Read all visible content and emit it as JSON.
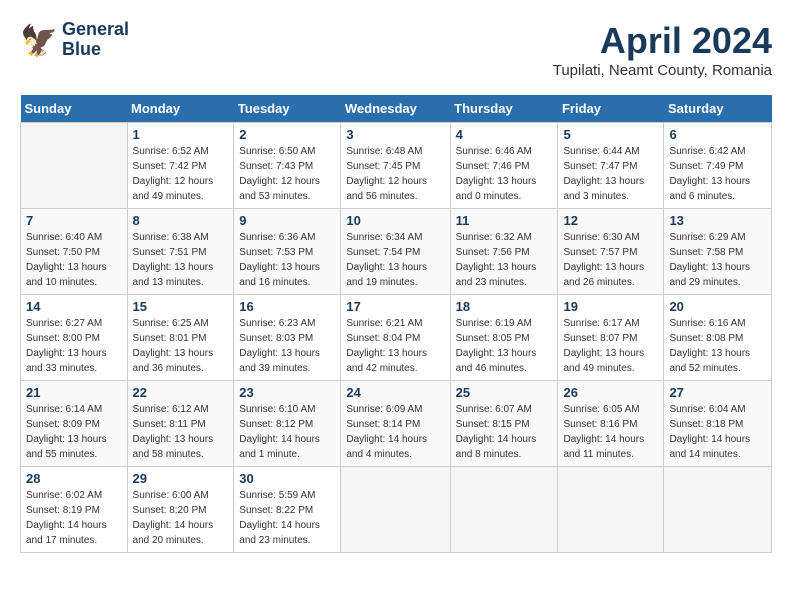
{
  "header": {
    "logo_line1": "General",
    "logo_line2": "Blue",
    "month": "April 2024",
    "location": "Tupilati, Neamt County, Romania"
  },
  "days_of_week": [
    "Sunday",
    "Monday",
    "Tuesday",
    "Wednesday",
    "Thursday",
    "Friday",
    "Saturday"
  ],
  "weeks": [
    [
      {
        "day": "",
        "info": ""
      },
      {
        "day": "1",
        "info": "Sunrise: 6:52 AM\nSunset: 7:42 PM\nDaylight: 12 hours\nand 49 minutes."
      },
      {
        "day": "2",
        "info": "Sunrise: 6:50 AM\nSunset: 7:43 PM\nDaylight: 12 hours\nand 53 minutes."
      },
      {
        "day": "3",
        "info": "Sunrise: 6:48 AM\nSunset: 7:45 PM\nDaylight: 12 hours\nand 56 minutes."
      },
      {
        "day": "4",
        "info": "Sunrise: 6:46 AM\nSunset: 7:46 PM\nDaylight: 13 hours\nand 0 minutes."
      },
      {
        "day": "5",
        "info": "Sunrise: 6:44 AM\nSunset: 7:47 PM\nDaylight: 13 hours\nand 3 minutes."
      },
      {
        "day": "6",
        "info": "Sunrise: 6:42 AM\nSunset: 7:49 PM\nDaylight: 13 hours\nand 6 minutes."
      }
    ],
    [
      {
        "day": "7",
        "info": "Sunrise: 6:40 AM\nSunset: 7:50 PM\nDaylight: 13 hours\nand 10 minutes."
      },
      {
        "day": "8",
        "info": "Sunrise: 6:38 AM\nSunset: 7:51 PM\nDaylight: 13 hours\nand 13 minutes."
      },
      {
        "day": "9",
        "info": "Sunrise: 6:36 AM\nSunset: 7:53 PM\nDaylight: 13 hours\nand 16 minutes."
      },
      {
        "day": "10",
        "info": "Sunrise: 6:34 AM\nSunset: 7:54 PM\nDaylight: 13 hours\nand 19 minutes."
      },
      {
        "day": "11",
        "info": "Sunrise: 6:32 AM\nSunset: 7:56 PM\nDaylight: 13 hours\nand 23 minutes."
      },
      {
        "day": "12",
        "info": "Sunrise: 6:30 AM\nSunset: 7:57 PM\nDaylight: 13 hours\nand 26 minutes."
      },
      {
        "day": "13",
        "info": "Sunrise: 6:29 AM\nSunset: 7:58 PM\nDaylight: 13 hours\nand 29 minutes."
      }
    ],
    [
      {
        "day": "14",
        "info": "Sunrise: 6:27 AM\nSunset: 8:00 PM\nDaylight: 13 hours\nand 33 minutes."
      },
      {
        "day": "15",
        "info": "Sunrise: 6:25 AM\nSunset: 8:01 PM\nDaylight: 13 hours\nand 36 minutes."
      },
      {
        "day": "16",
        "info": "Sunrise: 6:23 AM\nSunset: 8:03 PM\nDaylight: 13 hours\nand 39 minutes."
      },
      {
        "day": "17",
        "info": "Sunrise: 6:21 AM\nSunset: 8:04 PM\nDaylight: 13 hours\nand 42 minutes."
      },
      {
        "day": "18",
        "info": "Sunrise: 6:19 AM\nSunset: 8:05 PM\nDaylight: 13 hours\nand 46 minutes."
      },
      {
        "day": "19",
        "info": "Sunrise: 6:17 AM\nSunset: 8:07 PM\nDaylight: 13 hours\nand 49 minutes."
      },
      {
        "day": "20",
        "info": "Sunrise: 6:16 AM\nSunset: 8:08 PM\nDaylight: 13 hours\nand 52 minutes."
      }
    ],
    [
      {
        "day": "21",
        "info": "Sunrise: 6:14 AM\nSunset: 8:09 PM\nDaylight: 13 hours\nand 55 minutes."
      },
      {
        "day": "22",
        "info": "Sunrise: 6:12 AM\nSunset: 8:11 PM\nDaylight: 13 hours\nand 58 minutes."
      },
      {
        "day": "23",
        "info": "Sunrise: 6:10 AM\nSunset: 8:12 PM\nDaylight: 14 hours\nand 1 minute."
      },
      {
        "day": "24",
        "info": "Sunrise: 6:09 AM\nSunset: 8:14 PM\nDaylight: 14 hours\nand 4 minutes."
      },
      {
        "day": "25",
        "info": "Sunrise: 6:07 AM\nSunset: 8:15 PM\nDaylight: 14 hours\nand 8 minutes."
      },
      {
        "day": "26",
        "info": "Sunrise: 6:05 AM\nSunset: 8:16 PM\nDaylight: 14 hours\nand 11 minutes."
      },
      {
        "day": "27",
        "info": "Sunrise: 6:04 AM\nSunset: 8:18 PM\nDaylight: 14 hours\nand 14 minutes."
      }
    ],
    [
      {
        "day": "28",
        "info": "Sunrise: 6:02 AM\nSunset: 8:19 PM\nDaylight: 14 hours\nand 17 minutes."
      },
      {
        "day": "29",
        "info": "Sunrise: 6:00 AM\nSunset: 8:20 PM\nDaylight: 14 hours\nand 20 minutes."
      },
      {
        "day": "30",
        "info": "Sunrise: 5:59 AM\nSunset: 8:22 PM\nDaylight: 14 hours\nand 23 minutes."
      },
      {
        "day": "",
        "info": ""
      },
      {
        "day": "",
        "info": ""
      },
      {
        "day": "",
        "info": ""
      },
      {
        "day": "",
        "info": ""
      }
    ]
  ]
}
